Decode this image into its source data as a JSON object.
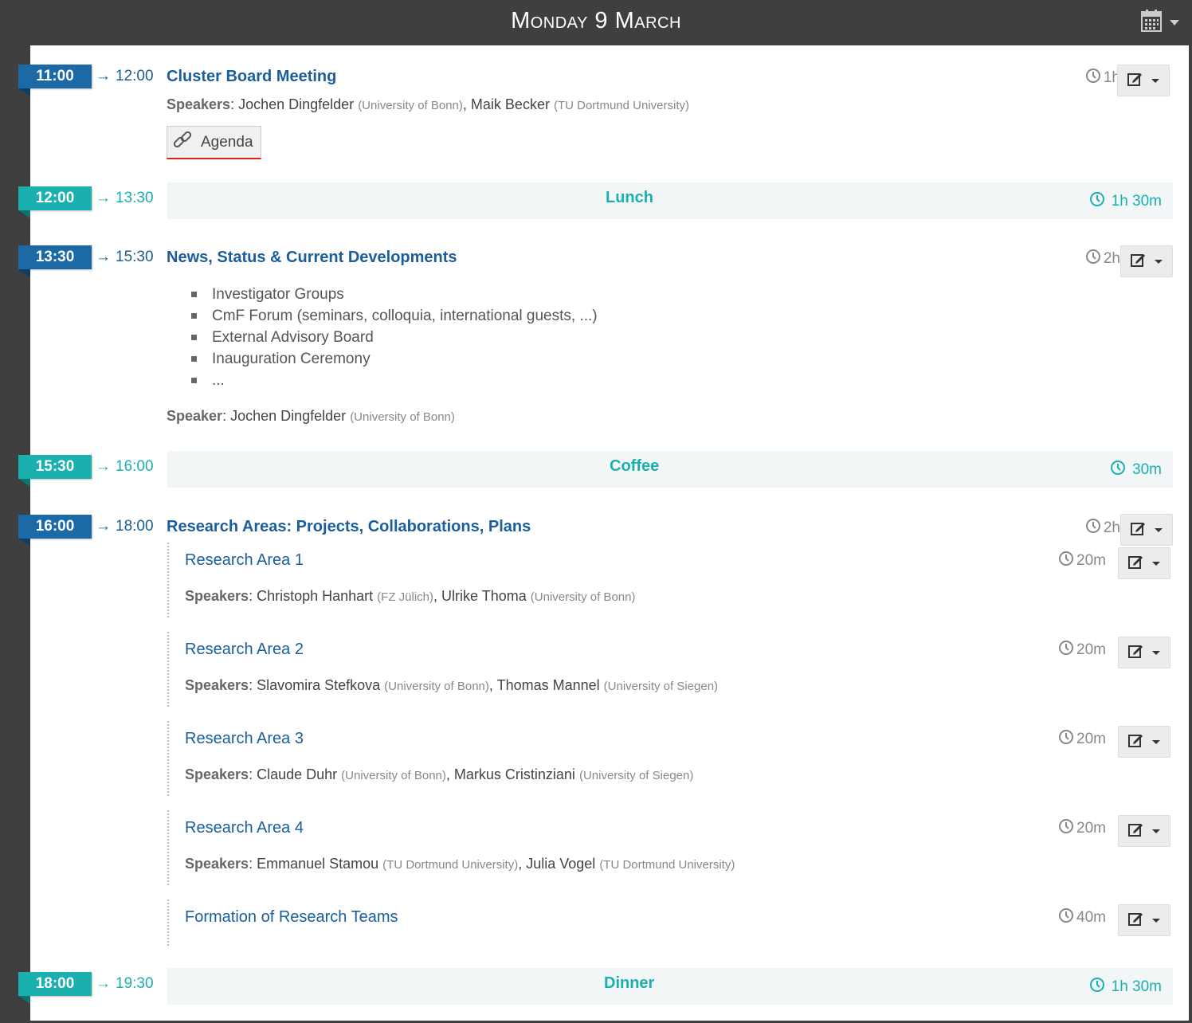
{
  "header": {
    "title": "Monday 9 March"
  },
  "entries": [
    {
      "start": "11:00",
      "end": "12:00",
      "title": "Cluster Board Meeting",
      "duration": "1h",
      "speakers_label": "Speakers",
      "speakers": [
        {
          "name": "Jochen Dingfelder",
          "affiliation": "(University of Bonn)"
        },
        {
          "name": "Maik Becker",
          "affiliation": "(TU Dortmund University)"
        }
      ],
      "agenda_label": "Agenda"
    },
    {
      "start": "12:00",
      "end": "13:30",
      "title": "Lunch",
      "duration": "1h 30m"
    },
    {
      "start": "13:30",
      "end": "15:30",
      "title": "News, Status & Current Developments",
      "duration": "2h",
      "bullets": [
        "Investigator Groups",
        "CmF Forum (seminars, colloquia, international guests, ...)",
        "External Advisory Board",
        "Inauguration Ceremony",
        "..."
      ],
      "speakers_label": "Speaker",
      "speakers": [
        {
          "name": "Jochen Dingfelder",
          "affiliation": "(University of Bonn)"
        }
      ]
    },
    {
      "start": "15:30",
      "end": "16:00",
      "title": "Coffee",
      "duration": "30m"
    },
    {
      "start": "16:00",
      "end": "18:00",
      "title": "Research Areas: Projects, Collaborations, Plans",
      "duration": "2h",
      "contributions": [
        {
          "title": "Research Area 1",
          "duration": "20m",
          "speakers_label": "Speakers",
          "speakers": [
            {
              "name": "Christoph Hanhart",
              "affiliation": "(FZ Jülich)"
            },
            {
              "name": "Ulrike Thoma",
              "affiliation": "(University of Bonn)"
            }
          ]
        },
        {
          "title": "Research Area 2",
          "duration": "20m",
          "speakers_label": "Speakers",
          "speakers": [
            {
              "name": "Slavomira Stefkova",
              "affiliation": "(University of Bonn)"
            },
            {
              "name": "Thomas Mannel",
              "affiliation": "(University of Siegen)"
            }
          ]
        },
        {
          "title": "Research Area 3",
          "duration": "20m",
          "speakers_label": "Speakers",
          "speakers": [
            {
              "name": "Claude Duhr",
              "affiliation": "(University of Bonn)"
            },
            {
              "name": "Markus Cristinziani",
              "affiliation": "(University of Siegen)"
            }
          ]
        },
        {
          "title": "Research Area 4",
          "duration": "20m",
          "speakers_label": "Speakers",
          "speakers": [
            {
              "name": "Emmanuel Stamou",
              "affiliation": "(TU Dortmund University)"
            },
            {
              "name": "Julia Vogel",
              "affiliation": "(TU Dortmund University)"
            }
          ]
        },
        {
          "title": "Formation of Research Teams",
          "duration": "40m"
        }
      ]
    },
    {
      "start": "18:00",
      "end": "19:30",
      "title": "Dinner",
      "duration": "1h 30m"
    }
  ],
  "colors": {
    "talk": "#1b6aa5",
    "break": "#1ab0b0",
    "title": "#1b5e9b"
  },
  "icons": {
    "calendar": "calendar-icon",
    "clock": "clock-icon",
    "edit": "edit-icon",
    "link": "link-icon",
    "arrow": "→"
  }
}
